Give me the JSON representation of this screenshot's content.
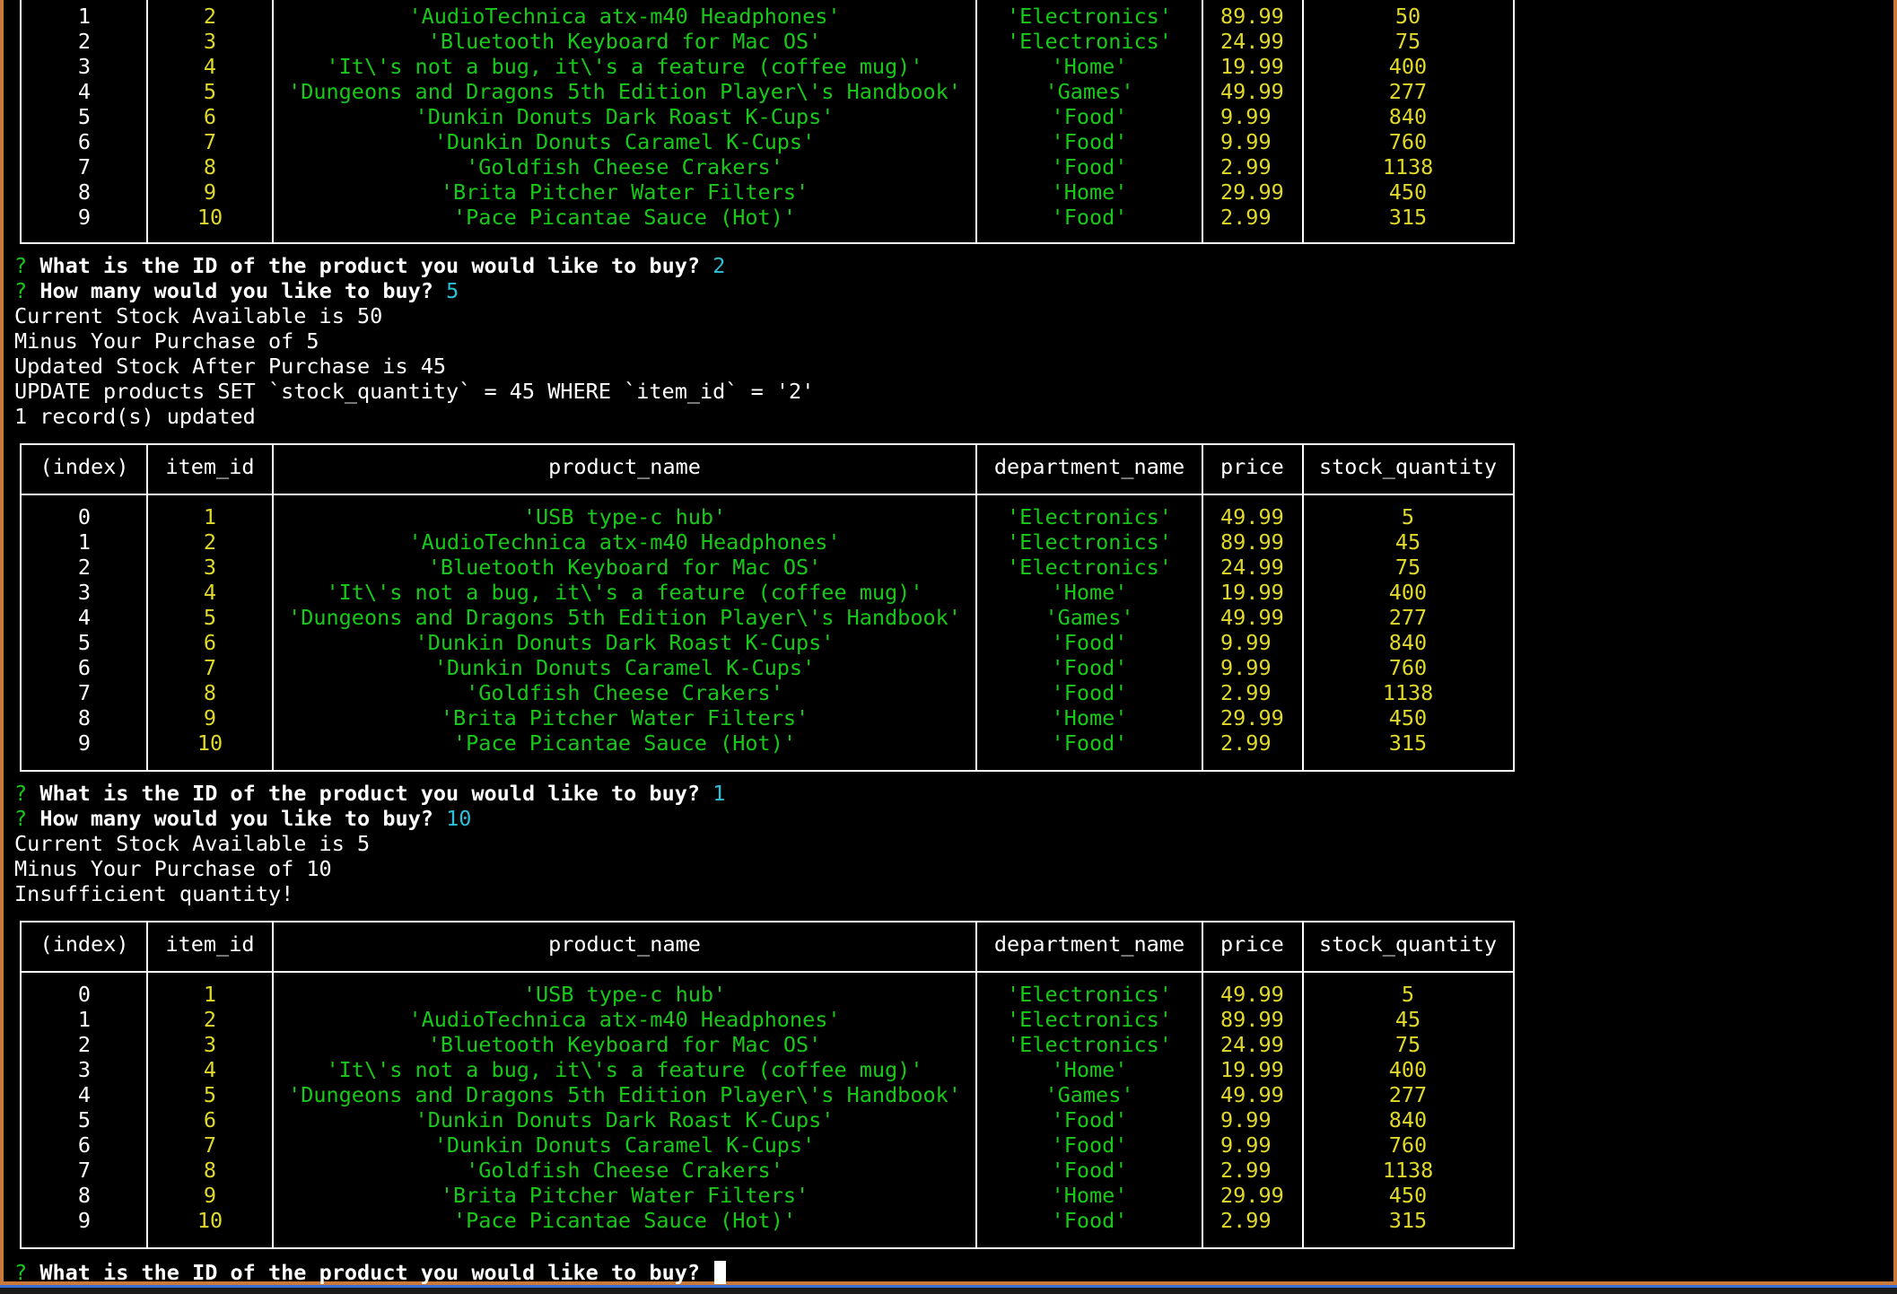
{
  "headers": [
    "(index)",
    "item_id",
    "product_name",
    "department_name",
    "price",
    "stock_quantity"
  ],
  "top_rows": [
    [
      "1",
      "2",
      "'AudioTechnica atx-m40 Headphones'",
      "'Electronics'",
      "89.99",
      "50"
    ],
    [
      "2",
      "3",
      "'Bluetooth Keyboard for Mac OS'",
      "'Electronics'",
      "24.99",
      "75"
    ],
    [
      "3",
      "4",
      "'It\\'s not a bug, it\\'s a feature (coffee mug)'",
      "'Home'",
      "19.99",
      "400"
    ],
    [
      "4",
      "5",
      "'Dungeons and Dragons 5th Edition Player\\'s Handbook'",
      "'Games'",
      "49.99",
      "277"
    ],
    [
      "5",
      "6",
      "'Dunkin Donuts Dark Roast K-Cups'",
      "'Food'",
      "9.99",
      "840"
    ],
    [
      "6",
      "7",
      "'Dunkin Donuts Caramel K-Cups'",
      "'Food'",
      "9.99",
      "760"
    ],
    [
      "7",
      "8",
      "'Goldfish Cheese Crakers'",
      "'Food'",
      "2.99",
      "1138"
    ],
    [
      "8",
      "9",
      "'Brita Pitcher Water Filters'",
      "'Home'",
      "29.99",
      "450"
    ],
    [
      "9",
      "10",
      "'Pace Picantae Sauce (Hot)'",
      "'Food'",
      "2.99",
      "315"
    ]
  ],
  "mid_rows": [
    [
      "0",
      "1",
      "'USB type-c hub'",
      "'Electronics'",
      "49.99",
      "5"
    ],
    [
      "1",
      "2",
      "'AudioTechnica atx-m40 Headphones'",
      "'Electronics'",
      "89.99",
      "45"
    ],
    [
      "2",
      "3",
      "'Bluetooth Keyboard for Mac OS'",
      "'Electronics'",
      "24.99",
      "75"
    ],
    [
      "3",
      "4",
      "'It\\'s not a bug, it\\'s a feature (coffee mug)'",
      "'Home'",
      "19.99",
      "400"
    ],
    [
      "4",
      "5",
      "'Dungeons and Dragons 5th Edition Player\\'s Handbook'",
      "'Games'",
      "49.99",
      "277"
    ],
    [
      "5",
      "6",
      "'Dunkin Donuts Dark Roast K-Cups'",
      "'Food'",
      "9.99",
      "840"
    ],
    [
      "6",
      "7",
      "'Dunkin Donuts Caramel K-Cups'",
      "'Food'",
      "9.99",
      "760"
    ],
    [
      "7",
      "8",
      "'Goldfish Cheese Crakers'",
      "'Food'",
      "2.99",
      "1138"
    ],
    [
      "8",
      "9",
      "'Brita Pitcher Water Filters'",
      "'Home'",
      "29.99",
      "450"
    ],
    [
      "9",
      "10",
      "'Pace Picantae Sauce (Hot)'",
      "'Food'",
      "2.99",
      "315"
    ]
  ],
  "bottom_rows": [
    [
      "0",
      "1",
      "'USB type-c hub'",
      "'Electronics'",
      "49.99",
      "5"
    ],
    [
      "1",
      "2",
      "'AudioTechnica atx-m40 Headphones'",
      "'Electronics'",
      "89.99",
      "45"
    ],
    [
      "2",
      "3",
      "'Bluetooth Keyboard for Mac OS'",
      "'Electronics'",
      "24.99",
      "75"
    ],
    [
      "3",
      "4",
      "'It\\'s not a bug, it\\'s a feature (coffee mug)'",
      "'Home'",
      "19.99",
      "400"
    ],
    [
      "4",
      "5",
      "'Dungeons and Dragons 5th Edition Player\\'s Handbook'",
      "'Games'",
      "49.99",
      "277"
    ],
    [
      "5",
      "6",
      "'Dunkin Donuts Dark Roast K-Cups'",
      "'Food'",
      "9.99",
      "840"
    ],
    [
      "6",
      "7",
      "'Dunkin Donuts Caramel K-Cups'",
      "'Food'",
      "9.99",
      "760"
    ],
    [
      "7",
      "8",
      "'Goldfish Cheese Crakers'",
      "'Food'",
      "2.99",
      "1138"
    ],
    [
      "8",
      "9",
      "'Brita Pitcher Water Filters'",
      "'Home'",
      "29.99",
      "450"
    ],
    [
      "9",
      "10",
      "'Pace Picantae Sauce (Hot)'",
      "'Food'",
      "2.99",
      "315"
    ]
  ],
  "session1": {
    "q_mark": "?",
    "q1_text": "What is the ID of the product you would like to buy?",
    "q1_answer": "2",
    "q2_text": "How many would you like to buy?",
    "q2_answer": "5",
    "out1": "Current Stock Available is 50",
    "out2": "Minus Your Purchase of 5",
    "out3": "Updated Stock After Purchase is 45",
    "out4": "UPDATE products SET `stock_quantity` = 45 WHERE `item_id` = '2'",
    "out5": "1 record(s) updated"
  },
  "session2": {
    "q_mark": "?",
    "q1_text": "What is the ID of the product you would like to buy?",
    "q1_answer": "1",
    "q2_text": "How many would you like to buy?",
    "q2_answer": "10",
    "out1": "Current Stock Available is 5",
    "out2": "Minus Your Purchase of 10",
    "out3": "Insufficient quantity!"
  },
  "prompt": {
    "q_mark": "?",
    "text": "What is the ID of the product you would like to buy?"
  },
  "colors": {
    "frame_border": "#c97a3a",
    "question_mark": "#19c919",
    "answer": "#2ac0d8",
    "string_value": "#19c919",
    "number_value": "#e0d82a"
  }
}
